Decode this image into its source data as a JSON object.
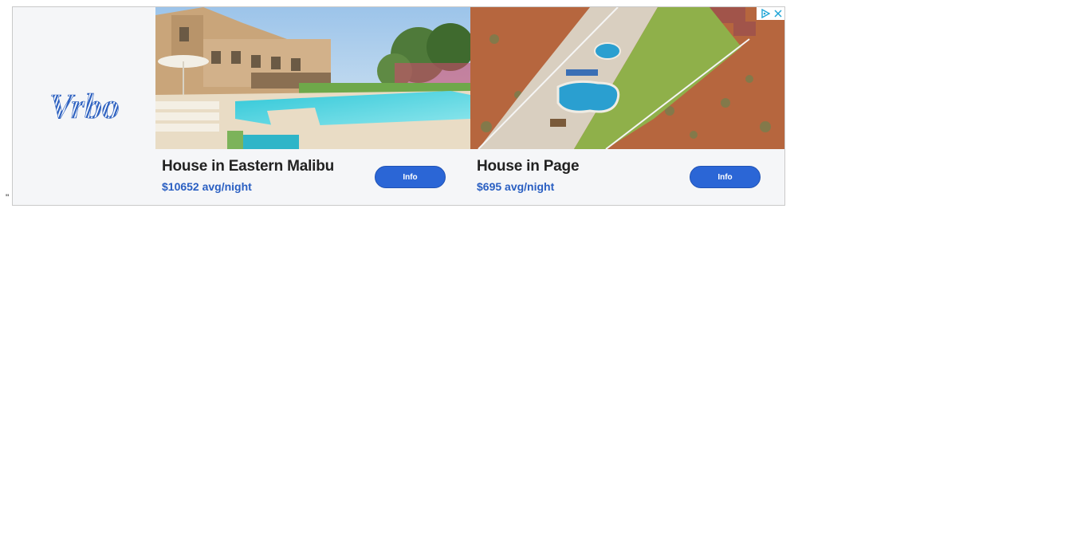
{
  "stray_text": "\"",
  "brand": {
    "logo_text": "Vrbo",
    "color": "#2b5fbf"
  },
  "listings": [
    {
      "title": "House in Eastern Malibu",
      "price": "$10652 avg/night",
      "button_label": "Info",
      "photo_icon": "villa-pool-photo"
    },
    {
      "title": "House in Page",
      "price": "$695 avg/night",
      "button_label": "Info",
      "photo_icon": "desert-pool-aerial-photo"
    }
  ],
  "adchoices": {
    "info_icon": "adchoices-icon",
    "close_icon": "close-icon"
  },
  "colors": {
    "accent": "#2b66d6",
    "price": "#2a5fc2",
    "banner_bg": "#f5f6f8"
  }
}
